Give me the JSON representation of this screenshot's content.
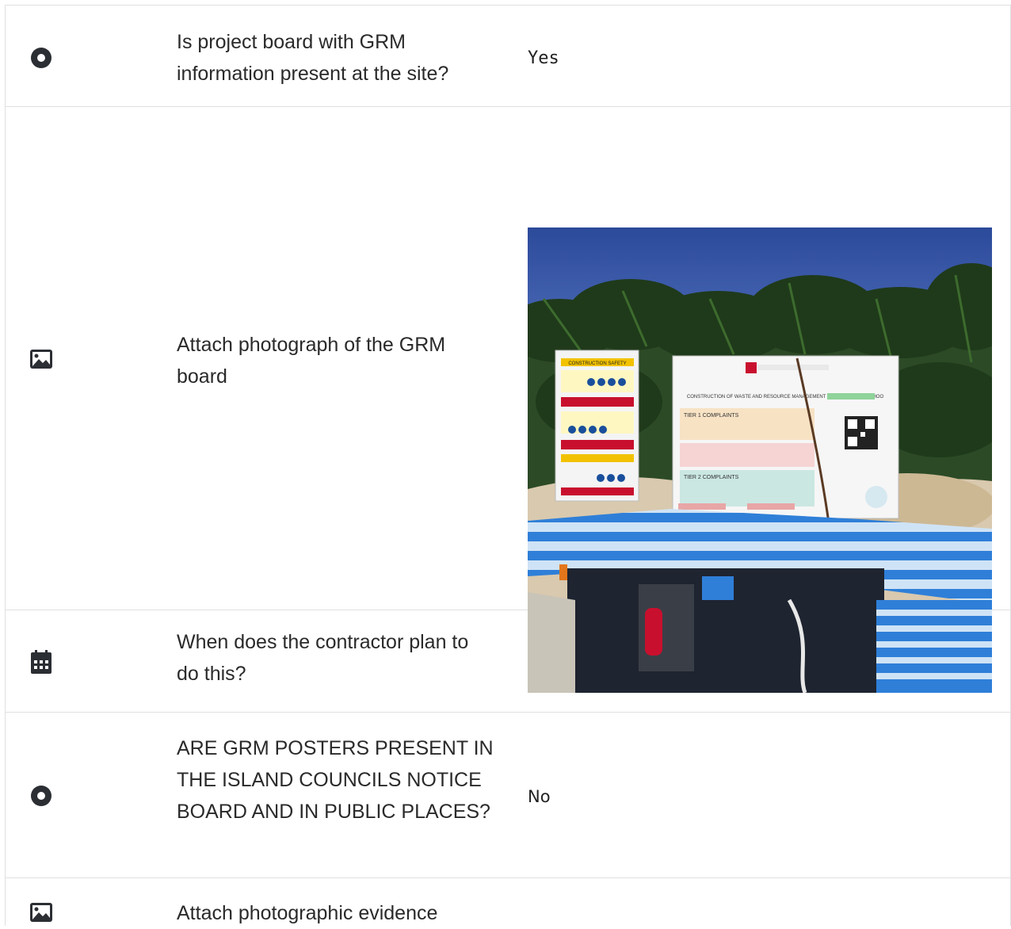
{
  "rows": [
    {
      "icon": "radio-icon",
      "question": "Is project board with GRM information present at the site?",
      "answer": "Yes"
    },
    {
      "icon": "image-icon",
      "question": "Attach photograph of the GRM board",
      "answer": ""
    },
    {
      "icon": "calendar-icon",
      "question": "When does the contractor plan to do this?",
      "answer": ""
    },
    {
      "icon": "radio-icon",
      "question": "ARE GRM POSTERS PRESENT IN THE ISLAND COUNCILS NOTICE BOARD AND IN PUBLIC PLACES?",
      "answer": "No"
    },
    {
      "icon": "image-icon",
      "question": "Attach photographic evidence",
      "answer": ""
    }
  ],
  "photo": {
    "board_header": "CONSTRUCTION OF WASTE AND RESOURCE MANAGEMENT CENTRE TH. KINBIDHOO",
    "tier1": "TIER 1 COMPLAINTS",
    "tier2": "TIER 2 COMPLAINTS",
    "safety": "CONSTRUCTION SAFETY"
  }
}
